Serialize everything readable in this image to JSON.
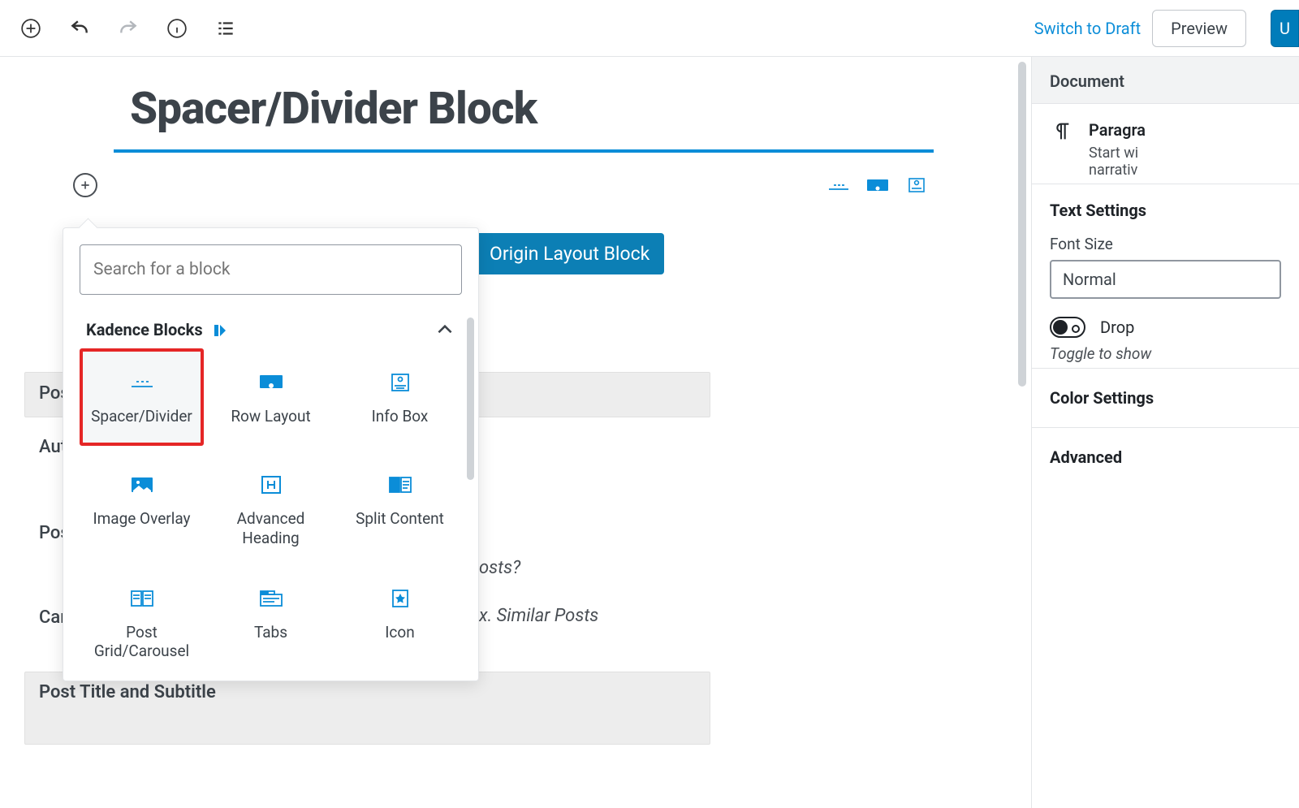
{
  "topbar": {
    "switch_draft": "Switch to Draft",
    "preview": "Preview",
    "update": "U"
  },
  "page": {
    "title": "Spacer/Divider Block",
    "chip": "Origin Layout Block",
    "bg_labels": [
      "Pos",
      "Aut",
      "Pos",
      "Car"
    ],
    "italic_posts": "osts?",
    "italic_similar": "x. Similar Posts",
    "band_label": "Post Title and Subtitle"
  },
  "inserter": {
    "search_placeholder": "Search for a block",
    "section": "Kadence Blocks",
    "blocks": [
      "Spacer/Divider",
      "Row Layout",
      "Info Box",
      "Image Overlay",
      "Advanced Heading",
      "Split Content",
      "Post Grid/Carousel",
      "Tabs",
      "Icon"
    ]
  },
  "sidebar": {
    "tab": "Document",
    "para_title": "Paragra",
    "para_sub1": "Start wi",
    "para_sub2": "narrativ",
    "text_settings": "Text Settings",
    "font_size_label": "Font Size",
    "font_size_value": "Normal",
    "drop": "Drop",
    "drop_hint": "Toggle to show",
    "color_settings": "Color Settings",
    "advanced": "Advanced"
  }
}
